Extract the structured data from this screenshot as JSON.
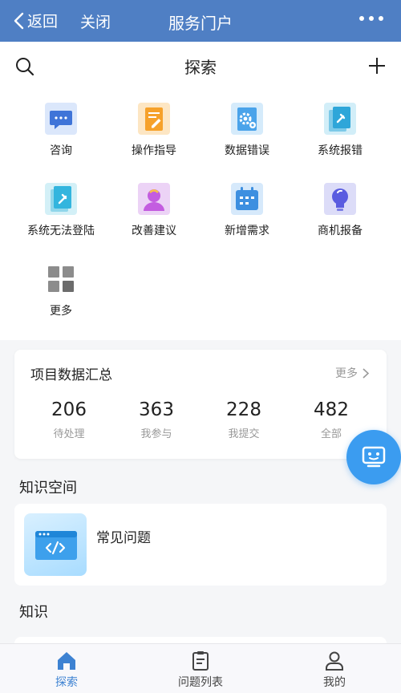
{
  "navbar": {
    "back_label": "返回",
    "close_label": "关闭",
    "title": "服务门户"
  },
  "header": {
    "title": "探索"
  },
  "grid": {
    "items": [
      {
        "label": "咨询",
        "icon": "chat-icon"
      },
      {
        "label": "操作指导",
        "icon": "edit-doc-icon"
      },
      {
        "label": "数据错误",
        "icon": "gear-doc-icon"
      },
      {
        "label": "系统报错",
        "icon": "tool-doc-icon"
      },
      {
        "label": "系统无法登陆",
        "icon": "wrench-doc-icon"
      },
      {
        "label": "改善建议",
        "icon": "person-idea-icon"
      },
      {
        "label": "新增需求",
        "icon": "calendar-icon"
      },
      {
        "label": "商机报备",
        "icon": "lightbulb-icon"
      },
      {
        "label": "更多",
        "icon": "grid-more-icon"
      }
    ]
  },
  "stats": {
    "title": "项目数据汇总",
    "more_label": "更多",
    "items": [
      {
        "value": "206",
        "label": "待处理"
      },
      {
        "value": "363",
        "label": "我参与"
      },
      {
        "value": "228",
        "label": "我提交"
      },
      {
        "value": "482",
        "label": "全部"
      }
    ]
  },
  "knowledge_space": {
    "title": "知识空间",
    "card_label": "常见问题"
  },
  "knowledge": {
    "title": "知识"
  },
  "tabbar": {
    "items": [
      {
        "label": "探索",
        "active": true
      },
      {
        "label": "问题列表",
        "active": false
      },
      {
        "label": "我的",
        "active": false
      }
    ]
  },
  "colors": {
    "brand": "#4f7fc4",
    "accent": "#3b9cf0",
    "active_tab": "#3d82d2"
  }
}
